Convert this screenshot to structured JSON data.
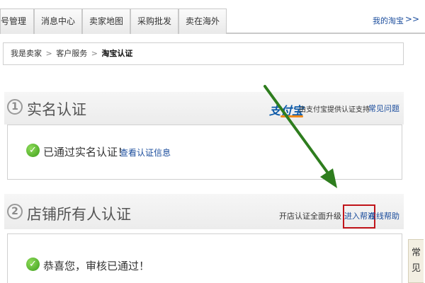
{
  "tabs": [
    {
      "label": "号管理"
    },
    {
      "label": "消息中心"
    },
    {
      "label": "卖家地图"
    },
    {
      "label": "采购批发"
    },
    {
      "label": "卖在海外"
    }
  ],
  "my_taobao": {
    "label": "我的淘宝",
    "arrow": ">>"
  },
  "breadcrumb": {
    "items": [
      "我是卖家",
      "客户服务"
    ],
    "separator": ">",
    "current": "淘宝认证"
  },
  "section1": {
    "number": "1",
    "title": "实名认证",
    "alipay_logo": "支付宝",
    "provider_note": "由支付宝提供认证支持",
    "faq": "常见问题",
    "status": "已通过实名认证！",
    "view_info": "查看认证信息"
  },
  "section2": {
    "number": "2",
    "title": "店铺所有人认证",
    "upgrade": "开店认证全面升级",
    "enter_helper": "进入帮派",
    "online_help": "在线帮助",
    "status": "恭喜您，审核已通过！"
  },
  "side_tab": {
    "label": "常见"
  },
  "colors": {
    "link": "#1a4c9c",
    "highlight_border": "#c0141a",
    "check_green": "#3c9d1a",
    "annotation_arrow": "#2e7d1e"
  }
}
